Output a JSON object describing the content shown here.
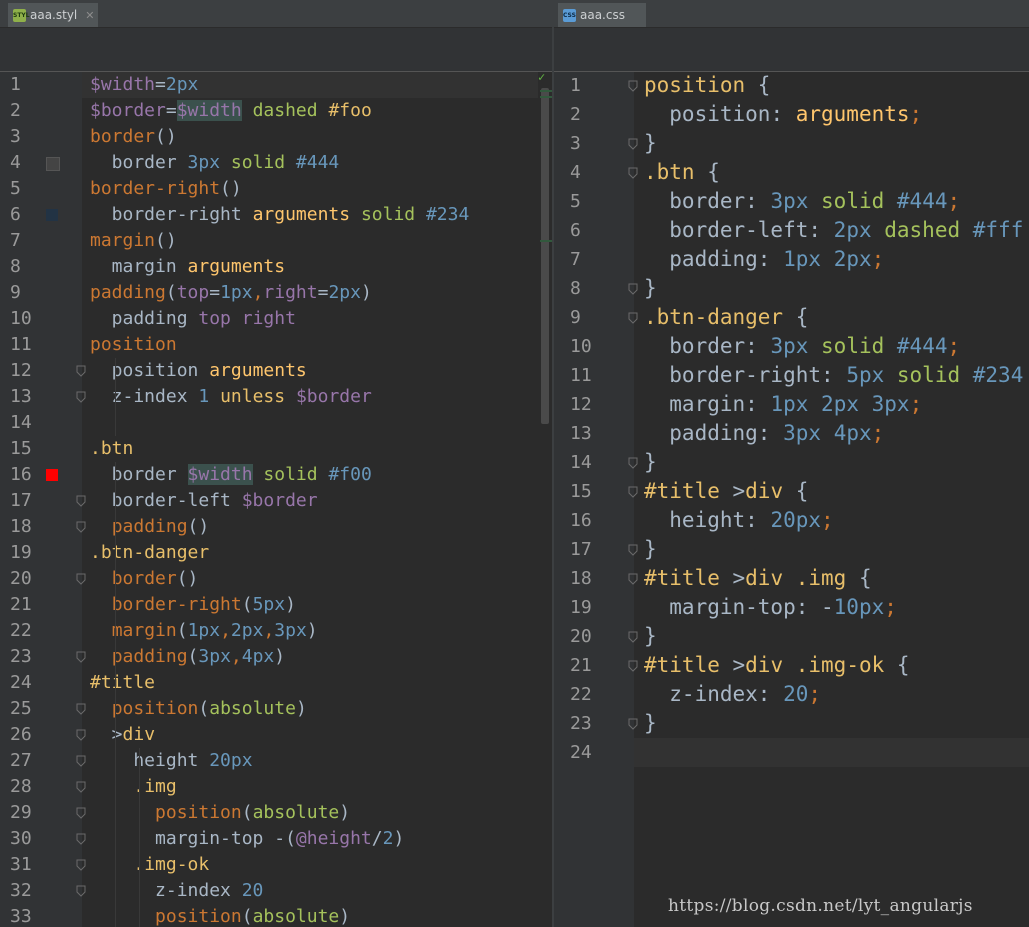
{
  "tabs": {
    "left": {
      "label": "aaa.styl",
      "icon": "styl-file-icon",
      "icon_text": "STYL"
    },
    "right": {
      "label": "aaa.css",
      "icon": "css-file-icon",
      "icon_text": "CSS"
    }
  },
  "left_lines": [
    {
      "n": "1",
      "t": [
        [
          "$width",
          "var"
        ],
        [
          "=",
          "p"
        ],
        [
          "2px",
          "num"
        ]
      ]
    },
    {
      "n": "2",
      "t": [
        [
          "$border",
          "var"
        ],
        [
          "=",
          "p"
        ],
        [
          "$width",
          "var hl"
        ],
        [
          " dashed ",
          "str"
        ],
        [
          "#foo",
          "sel"
        ]
      ]
    },
    {
      "n": "3",
      "t": [
        [
          "border",
          "fn"
        ],
        [
          "()",
          "p"
        ]
      ]
    },
    {
      "n": "4",
      "t": [
        [
          "  border ",
          "p"
        ],
        [
          "3px",
          "num"
        ],
        [
          " solid ",
          "str"
        ],
        [
          "#444",
          "num"
        ]
      ]
    },
    {
      "n": "5",
      "t": [
        [
          "border-right",
          "fn"
        ],
        [
          "()",
          "p"
        ]
      ]
    },
    {
      "n": "6",
      "t": [
        [
          "  border-right ",
          "p"
        ],
        [
          "arguments",
          "arg"
        ],
        [
          " solid ",
          "str"
        ],
        [
          "#234",
          "num"
        ]
      ]
    },
    {
      "n": "7",
      "t": [
        [
          "margin",
          "fn"
        ],
        [
          "()",
          "p"
        ]
      ]
    },
    {
      "n": "8",
      "t": [
        [
          "  margin ",
          "p"
        ],
        [
          "arguments",
          "arg"
        ]
      ]
    },
    {
      "n": "9",
      "t": [
        [
          "padding",
          "fn"
        ],
        [
          "(",
          "p"
        ],
        [
          "top",
          "var"
        ],
        [
          "=",
          "p"
        ],
        [
          "1px",
          "num"
        ],
        [
          ",",
          "kw"
        ],
        [
          "right",
          "var"
        ],
        [
          "=",
          "p"
        ],
        [
          "2px",
          "num"
        ],
        [
          ")",
          "p"
        ]
      ]
    },
    {
      "n": "10",
      "t": [
        [
          "  padding ",
          "p"
        ],
        [
          "top",
          "var"
        ],
        [
          " ",
          "p"
        ],
        [
          "right",
          "var"
        ]
      ]
    },
    {
      "n": "11",
      "t": [
        [
          "position",
          "fn"
        ]
      ]
    },
    {
      "n": "12",
      "t": [
        [
          "  position ",
          "p"
        ],
        [
          "arguments",
          "arg"
        ]
      ]
    },
    {
      "n": "13",
      "t": [
        [
          "  z-index ",
          "p"
        ],
        [
          "1",
          "num"
        ],
        [
          " ",
          "p"
        ],
        [
          "unless",
          "sel"
        ],
        [
          " ",
          "p"
        ],
        [
          "$border",
          "var"
        ]
      ]
    },
    {
      "n": "14",
      "t": []
    },
    {
      "n": "15",
      "t": [
        [
          ".btn",
          "sel"
        ]
      ]
    },
    {
      "n": "16",
      "t": [
        [
          "  border ",
          "p"
        ],
        [
          "$width",
          "var hl"
        ],
        [
          " solid ",
          "str"
        ],
        [
          "#f00",
          "num"
        ]
      ]
    },
    {
      "n": "17",
      "t": [
        [
          "  border-left ",
          "p"
        ],
        [
          "$border",
          "var"
        ]
      ]
    },
    {
      "n": "18",
      "t": [
        [
          "  ",
          "p"
        ],
        [
          "padding",
          "fn"
        ],
        [
          "()",
          "p"
        ]
      ]
    },
    {
      "n": "19",
      "t": [
        [
          ".btn-danger",
          "sel"
        ]
      ]
    },
    {
      "n": "20",
      "t": [
        [
          "  ",
          "p"
        ],
        [
          "border",
          "fn"
        ],
        [
          "()",
          "p"
        ]
      ]
    },
    {
      "n": "21",
      "t": [
        [
          "  ",
          "p"
        ],
        [
          "border-right",
          "fn"
        ],
        [
          "(",
          "p"
        ],
        [
          "5px",
          "num"
        ],
        [
          ")",
          "p"
        ]
      ]
    },
    {
      "n": "22",
      "t": [
        [
          "  ",
          "p"
        ],
        [
          "margin",
          "fn"
        ],
        [
          "(",
          "p"
        ],
        [
          "1px",
          "num"
        ],
        [
          ",",
          "kw"
        ],
        [
          "2px",
          "num"
        ],
        [
          ",",
          "kw"
        ],
        [
          "3px",
          "num"
        ],
        [
          ")",
          "p"
        ]
      ]
    },
    {
      "n": "23",
      "t": [
        [
          "  ",
          "p"
        ],
        [
          "padding",
          "fn"
        ],
        [
          "(",
          "p"
        ],
        [
          "3px",
          "num"
        ],
        [
          ",",
          "kw"
        ],
        [
          "4px",
          "num"
        ],
        [
          ")",
          "p"
        ]
      ]
    },
    {
      "n": "24",
      "t": [
        [
          "#title",
          "sel"
        ]
      ]
    },
    {
      "n": "25",
      "t": [
        [
          "  ",
          "p"
        ],
        [
          "position",
          "fn"
        ],
        [
          "(",
          "p"
        ],
        [
          "absolute",
          "str"
        ],
        [
          ")",
          "p"
        ]
      ]
    },
    {
      "n": "26",
      "t": [
        [
          "  >",
          "p"
        ],
        [
          "div",
          "sel"
        ]
      ]
    },
    {
      "n": "27",
      "t": [
        [
          "    height ",
          "p"
        ],
        [
          "20px",
          "num"
        ]
      ]
    },
    {
      "n": "28",
      "t": [
        [
          "    ",
          "p"
        ],
        [
          ".img",
          "sel"
        ]
      ]
    },
    {
      "n": "29",
      "t": [
        [
          "      ",
          "p"
        ],
        [
          "position",
          "fn"
        ],
        [
          "(",
          "p"
        ],
        [
          "absolute",
          "str"
        ],
        [
          ")",
          "p"
        ]
      ]
    },
    {
      "n": "30",
      "t": [
        [
          "      margin-top -(",
          "p"
        ],
        [
          "@height",
          "var"
        ],
        [
          "/",
          "p"
        ],
        [
          "2",
          "num"
        ],
        [
          ")",
          "p"
        ]
      ]
    },
    {
      "n": "31",
      "t": [
        [
          "    ",
          "p"
        ],
        [
          ".img-ok",
          "sel"
        ]
      ]
    },
    {
      "n": "32",
      "t": [
        [
          "      z-index ",
          "p"
        ],
        [
          "20",
          "num"
        ]
      ]
    },
    {
      "n": "33",
      "t": [
        [
          "      ",
          "p"
        ],
        [
          "position",
          "fn"
        ],
        [
          "(",
          "p"
        ],
        [
          "absolute",
          "str"
        ],
        [
          ")",
          "p"
        ]
      ]
    }
  ],
  "right_lines": [
    {
      "n": "1",
      "t": [
        [
          "position",
          "sel"
        ],
        [
          " {",
          "p"
        ]
      ]
    },
    {
      "n": "2",
      "t": [
        [
          "  position",
          "p"
        ],
        [
          ": ",
          "p"
        ],
        [
          "arguments",
          "arg"
        ],
        [
          ";",
          "kw"
        ]
      ]
    },
    {
      "n": "3",
      "t": [
        [
          "}",
          "p"
        ]
      ]
    },
    {
      "n": "4",
      "t": [
        [
          ".btn",
          "sel"
        ],
        [
          " {",
          "p"
        ]
      ]
    },
    {
      "n": "5",
      "t": [
        [
          "  border",
          "p"
        ],
        [
          ": ",
          "p"
        ],
        [
          "3px",
          "num"
        ],
        [
          " solid ",
          "str"
        ],
        [
          "#444",
          "num"
        ],
        [
          ";",
          "kw"
        ]
      ]
    },
    {
      "n": "6",
      "t": [
        [
          "  border-left",
          "p"
        ],
        [
          ": ",
          "p"
        ],
        [
          "2px",
          "num"
        ],
        [
          " dashed ",
          "str"
        ],
        [
          "#fff",
          "num"
        ]
      ]
    },
    {
      "n": "7",
      "t": [
        [
          "  padding",
          "p"
        ],
        [
          ": ",
          "p"
        ],
        [
          "1px",
          "num"
        ],
        [
          " ",
          "p"
        ],
        [
          "2px",
          "num"
        ],
        [
          ";",
          "kw"
        ]
      ]
    },
    {
      "n": "8",
      "t": [
        [
          "}",
          "p"
        ]
      ]
    },
    {
      "n": "9",
      "t": [
        [
          ".btn-danger",
          "sel"
        ],
        [
          " {",
          "p"
        ]
      ]
    },
    {
      "n": "10",
      "t": [
        [
          "  border",
          "p"
        ],
        [
          ": ",
          "p"
        ],
        [
          "3px",
          "num"
        ],
        [
          " solid ",
          "str"
        ],
        [
          "#444",
          "num"
        ],
        [
          ";",
          "kw"
        ]
      ]
    },
    {
      "n": "11",
      "t": [
        [
          "  border-right",
          "p"
        ],
        [
          ": ",
          "p"
        ],
        [
          "5px",
          "num"
        ],
        [
          " solid ",
          "str"
        ],
        [
          "#234",
          "num"
        ]
      ]
    },
    {
      "n": "12",
      "t": [
        [
          "  margin",
          "p"
        ],
        [
          ": ",
          "p"
        ],
        [
          "1px",
          "num"
        ],
        [
          " ",
          "p"
        ],
        [
          "2px",
          "num"
        ],
        [
          " ",
          "p"
        ],
        [
          "3px",
          "num"
        ],
        [
          ";",
          "kw"
        ]
      ]
    },
    {
      "n": "13",
      "t": [
        [
          "  padding",
          "p"
        ],
        [
          ": ",
          "p"
        ],
        [
          "3px",
          "num"
        ],
        [
          " ",
          "p"
        ],
        [
          "4px",
          "num"
        ],
        [
          ";",
          "kw"
        ]
      ]
    },
    {
      "n": "14",
      "t": [
        [
          "}",
          "p"
        ]
      ]
    },
    {
      "n": "15",
      "t": [
        [
          "#title",
          "sel"
        ],
        [
          " >",
          "p"
        ],
        [
          "div",
          "sel"
        ],
        [
          " {",
          "p"
        ]
      ]
    },
    {
      "n": "16",
      "t": [
        [
          "  height",
          "p"
        ],
        [
          ": ",
          "p"
        ],
        [
          "20px",
          "num"
        ],
        [
          ";",
          "kw"
        ]
      ]
    },
    {
      "n": "17",
      "t": [
        [
          "}",
          "p"
        ]
      ]
    },
    {
      "n": "18",
      "t": [
        [
          "#title",
          "sel"
        ],
        [
          " >",
          "p"
        ],
        [
          "div",
          "sel"
        ],
        [
          " ",
          "p"
        ],
        [
          ".img",
          "sel"
        ],
        [
          " {",
          "p"
        ]
      ]
    },
    {
      "n": "19",
      "t": [
        [
          "  margin-top",
          "p"
        ],
        [
          ": -",
          "p"
        ],
        [
          "10px",
          "num"
        ],
        [
          ";",
          "kw"
        ]
      ]
    },
    {
      "n": "20",
      "t": [
        [
          "}",
          "p"
        ]
      ]
    },
    {
      "n": "21",
      "t": [
        [
          "#title",
          "sel"
        ],
        [
          " >",
          "p"
        ],
        [
          "div",
          "sel"
        ],
        [
          " ",
          "p"
        ],
        [
          ".img-ok",
          "sel"
        ],
        [
          " {",
          "p"
        ]
      ]
    },
    {
      "n": "22",
      "t": [
        [
          "  z-index",
          "p"
        ],
        [
          ": ",
          "p"
        ],
        [
          "20",
          "num"
        ],
        [
          ";",
          "kw"
        ]
      ]
    },
    {
      "n": "23",
      "t": [
        [
          "}",
          "p"
        ]
      ]
    },
    {
      "n": "24",
      "t": []
    }
  ],
  "left_swatches": [
    {
      "line": "4",
      "color": "#444444"
    },
    {
      "line": "6",
      "color": "#223344"
    },
    {
      "line": "16",
      "color": "#ff0000"
    }
  ],
  "left_folds": [
    "12",
    "13",
    "17",
    "18",
    "20",
    "23",
    "25",
    "26",
    "27",
    "28",
    "29",
    "30",
    "31",
    "32"
  ],
  "right_folds": [
    "1",
    "3",
    "4",
    "8",
    "9",
    "14",
    "15",
    "17",
    "18",
    "20",
    "21",
    "23"
  ],
  "status": {
    "analysis_ok": "✓"
  },
  "watermark": "https://blog.csdn.net/lyt_angularjs",
  "colors": {
    "background": "#2b2b2b",
    "gutter": "#313335",
    "selector": "#e8bf6a",
    "variable": "#9876aa",
    "number": "#6897bb",
    "function": "#cc7832",
    "string": "#a5c25c"
  }
}
